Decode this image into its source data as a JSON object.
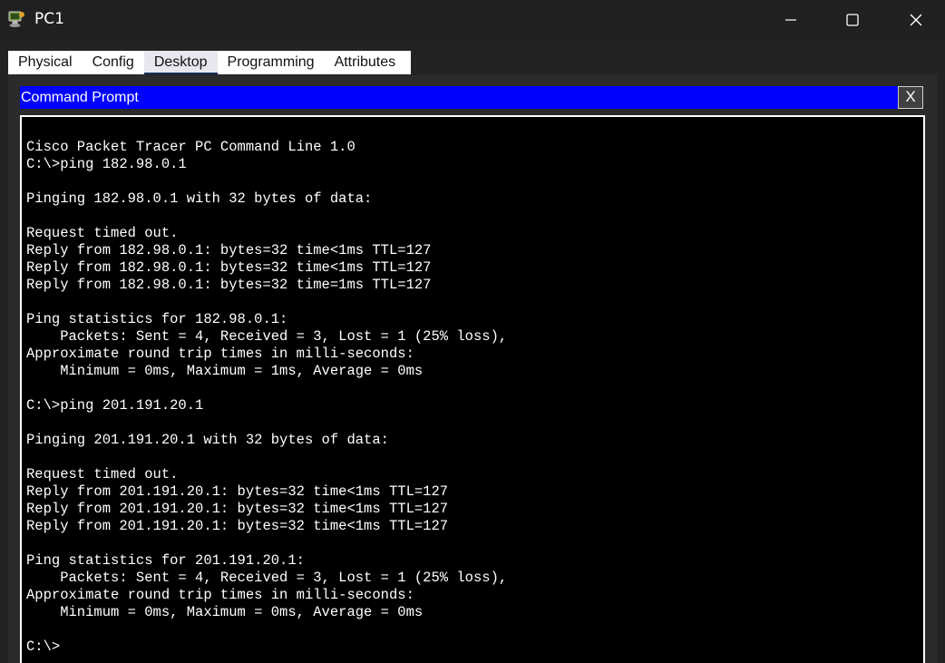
{
  "window": {
    "title": "PC1"
  },
  "tabs": [
    {
      "label": "Physical",
      "active": false
    },
    {
      "label": "Config",
      "active": false
    },
    {
      "label": "Desktop",
      "active": true
    },
    {
      "label": "Programming",
      "active": false
    },
    {
      "label": "Attributes",
      "active": false
    }
  ],
  "command_prompt": {
    "title": "Command Prompt",
    "close_label": "X",
    "output": "Cisco Packet Tracer PC Command Line 1.0\nC:\\>ping 182.98.0.1\n\nPinging 182.98.0.1 with 32 bytes of data:\n\nRequest timed out.\nReply from 182.98.0.1: bytes=32 time<1ms TTL=127\nReply from 182.98.0.1: bytes=32 time<1ms TTL=127\nReply from 182.98.0.1: bytes=32 time=1ms TTL=127\n\nPing statistics for 182.98.0.1:\n    Packets: Sent = 4, Received = 3, Lost = 1 (25% loss),\nApproximate round trip times in milli-seconds:\n    Minimum = 0ms, Maximum = 1ms, Average = 0ms\n\nC:\\>ping 201.191.20.1\n\nPinging 201.191.20.1 with 32 bytes of data:\n\nRequest timed out.\nReply from 201.191.20.1: bytes=32 time<1ms TTL=127\nReply from 201.191.20.1: bytes=32 time<1ms TTL=127\nReply from 201.191.20.1: bytes=32 time<1ms TTL=127\n\nPing statistics for 201.191.20.1:\n    Packets: Sent = 4, Received = 3, Lost = 1 (25% loss),\nApproximate round trip times in milli-seconds:\n    Minimum = 0ms, Maximum = 0ms, Average = 0ms\n\nC:\\>"
  },
  "icons": {
    "app": "packet-tracer-pc-icon",
    "minimize": "minimize-icon",
    "maximize": "maximize-icon",
    "close": "close-icon"
  },
  "colors": {
    "header_blue": "#0000ff",
    "terminal_bg": "#000000",
    "terminal_fg": "#ffffff",
    "titlebar_bg": "#202020"
  }
}
